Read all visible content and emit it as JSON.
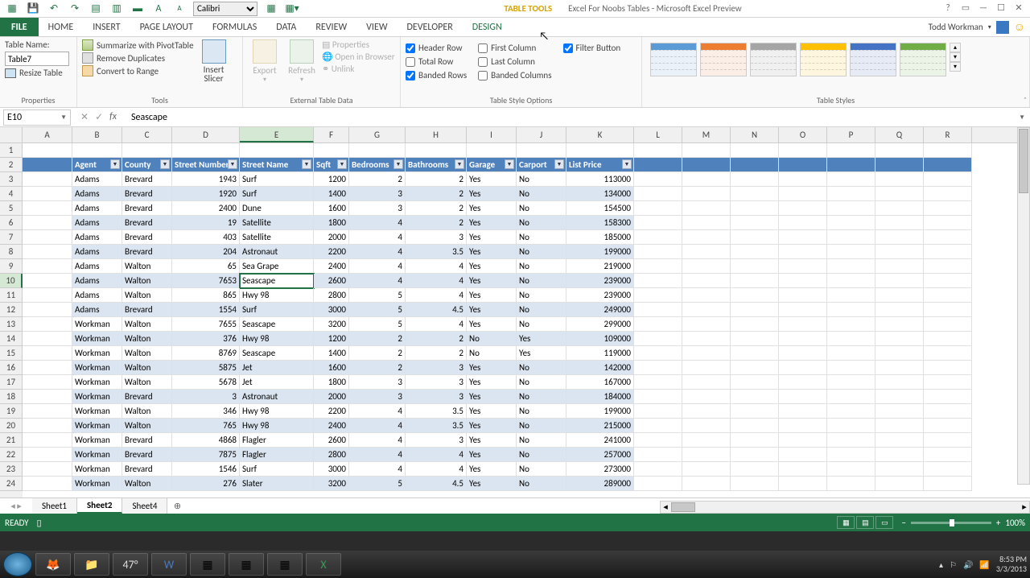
{
  "title": {
    "table_tools": "TABLE TOOLS",
    "app": "Excel For Noobs Tables - Microsoft Excel Preview"
  },
  "qat": {
    "font_name": "Calibri"
  },
  "tabs": {
    "file": "FILE",
    "home": "HOME",
    "insert": "INSERT",
    "page_layout": "PAGE LAYOUT",
    "formulas": "FORMULAS",
    "data": "DATA",
    "review": "REVIEW",
    "view": "VIEW",
    "developer": "DEVELOPER",
    "design": "DESIGN"
  },
  "user": {
    "name": "Todd Workman"
  },
  "ribbon": {
    "properties": {
      "label": "Properties",
      "table_name_label": "Table Name:",
      "table_name_value": "Table7",
      "resize": "Resize Table"
    },
    "tools": {
      "label": "Tools",
      "pivot": "Summarize with PivotTable",
      "dup": "Remove Duplicates",
      "conv": "Convert to Range",
      "slicer": "Insert\nSlicer"
    },
    "external": {
      "label": "External Table Data",
      "export": "Export",
      "refresh": "Refresh",
      "props": "Properties",
      "browser": "Open in Browser",
      "unlink": "Unlink"
    },
    "style_opts": {
      "label": "Table Style Options",
      "header_row": "Header Row",
      "total_row": "Total Row",
      "banded_rows": "Banded Rows",
      "first_col": "First Column",
      "last_col": "Last Column",
      "banded_cols": "Banded Columns",
      "filter": "Filter Button"
    },
    "styles": {
      "label": "Table Styles"
    }
  },
  "name_box": "E10",
  "formula": "Seascape",
  "columns": [
    "A",
    "B",
    "C",
    "D",
    "E",
    "F",
    "G",
    "H",
    "I",
    "J",
    "K",
    "L",
    "M",
    "N",
    "O",
    "P",
    "Q",
    "R"
  ],
  "active": {
    "row": 10,
    "col": "E"
  },
  "table": {
    "headers": [
      "Agent",
      "County",
      "Street Number",
      "Street Name",
      "Sqft",
      "Bedrooms",
      "Bathrooms",
      "Garage",
      "Carport",
      "List Price"
    ],
    "rows": [
      [
        "Adams",
        "Brevard",
        1943,
        "Surf",
        1200,
        2,
        2,
        "Yes",
        "No",
        113000
      ],
      [
        "Adams",
        "Brevard",
        1920,
        "Surf",
        1400,
        3,
        2,
        "Yes",
        "No",
        134000
      ],
      [
        "Adams",
        "Brevard",
        2400,
        "Dune",
        1600,
        3,
        2,
        "Yes",
        "No",
        154500
      ],
      [
        "Adams",
        "Brevard",
        19,
        "Satellite",
        1800,
        4,
        2,
        "Yes",
        "No",
        158300
      ],
      [
        "Adams",
        "Brevard",
        403,
        "Satellite",
        2000,
        4,
        3,
        "Yes",
        "No",
        185000
      ],
      [
        "Adams",
        "Brevard",
        204,
        "Astronaut",
        2200,
        4,
        3.5,
        "Yes",
        "No",
        199000
      ],
      [
        "Adams",
        "Walton",
        65,
        "Sea Grape",
        2400,
        4,
        4,
        "Yes",
        "No",
        219000
      ],
      [
        "Adams",
        "Walton",
        7653,
        "Seascape",
        2600,
        4,
        4,
        "Yes",
        "No",
        239000
      ],
      [
        "Adams",
        "Walton",
        865,
        "Hwy 98",
        2800,
        5,
        4,
        "Yes",
        "No",
        239000
      ],
      [
        "Adams",
        "Brevard",
        1554,
        "Surf",
        3000,
        5,
        4.5,
        "Yes",
        "No",
        249000
      ],
      [
        "Workman",
        "Walton",
        7655,
        "Seascape",
        3200,
        5,
        4,
        "Yes",
        "No",
        299000
      ],
      [
        "Workman",
        "Walton",
        376,
        "Hwy 98",
        1200,
        2,
        2,
        "No",
        "Yes",
        109000
      ],
      [
        "Workman",
        "Walton",
        8769,
        "Seascape",
        1400,
        2,
        2,
        "No",
        "Yes",
        119000
      ],
      [
        "Workman",
        "Walton",
        5875,
        "Jet",
        1600,
        2,
        3,
        "Yes",
        "No",
        142000
      ],
      [
        "Workman",
        "Walton",
        5678,
        "Jet",
        1800,
        3,
        3,
        "Yes",
        "No",
        167000
      ],
      [
        "Workman",
        "Brevard",
        3,
        "Astronaut",
        2000,
        3,
        3,
        "Yes",
        "No",
        184000
      ],
      [
        "Workman",
        "Walton",
        346,
        "Hwy 98",
        2200,
        4,
        3.5,
        "Yes",
        "No",
        199000
      ],
      [
        "Workman",
        "Walton",
        765,
        "Hwy 98",
        2400,
        4,
        3.5,
        "Yes",
        "No",
        215000
      ],
      [
        "Workman",
        "Brevard",
        4868,
        "Flagler",
        2600,
        4,
        3,
        "Yes",
        "No",
        241000
      ],
      [
        "Workman",
        "Brevard",
        7875,
        "Flagler",
        2800,
        4,
        4,
        "Yes",
        "No",
        257000
      ],
      [
        "Workman",
        "Brevard",
        1546,
        "Surf",
        3000,
        4,
        4,
        "Yes",
        "No",
        273000
      ],
      [
        "Workman",
        "Walton",
        276,
        "Slater",
        3200,
        5,
        4.5,
        "Yes",
        "No",
        289000
      ]
    ]
  },
  "sheets": {
    "s1": "Sheet1",
    "s2": "Sheet2",
    "s4": "Sheet4"
  },
  "status": {
    "ready": "READY",
    "zoom": "100%"
  },
  "taskbar": {
    "temp": "47°",
    "time": "8:53 PM",
    "date": "3/3/2013"
  }
}
